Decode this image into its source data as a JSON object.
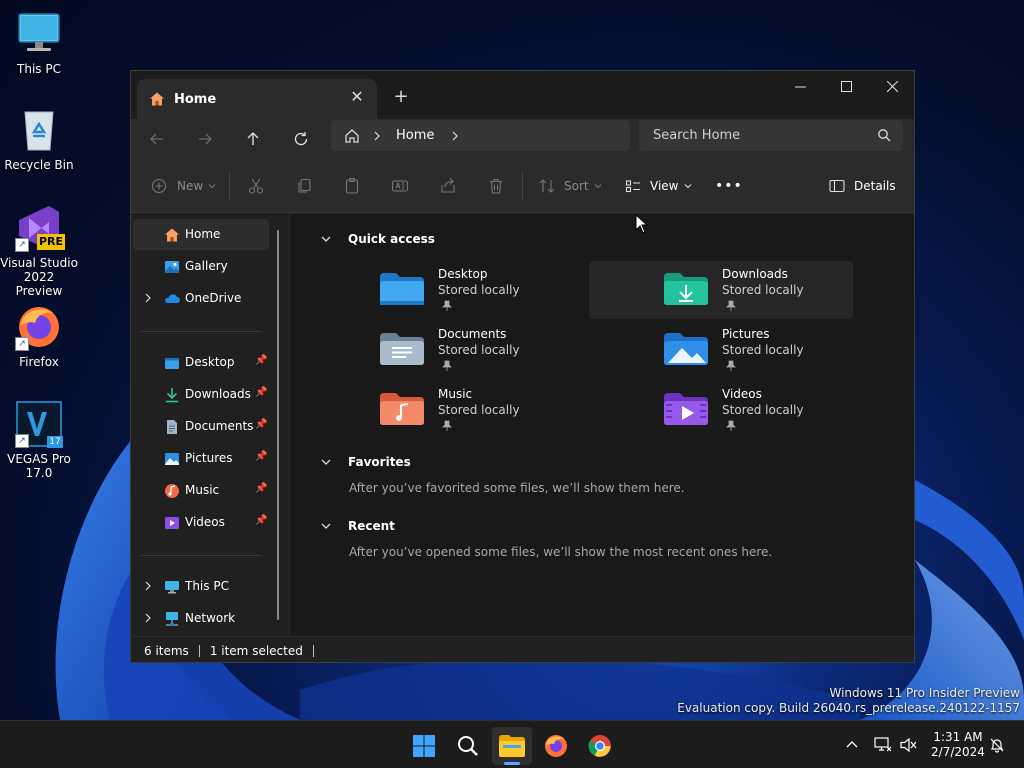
{
  "desktop": {
    "icons": [
      {
        "label": "This PC"
      },
      {
        "label": "Recycle Bin"
      },
      {
        "label": "Visual Studio 2022 Preview",
        "badge": "PRE"
      },
      {
        "label": "Firefox"
      },
      {
        "label": "VEGAS Pro 17.0",
        "badge": "17"
      }
    ],
    "watermark": {
      "line1": "Windows 11 Pro Insider Preview",
      "line2": "Evaluation copy. Build 26040.rs_prerelease.240122-1157"
    }
  },
  "window": {
    "tab_title": "Home",
    "new_tab_symbol": "+",
    "address": {
      "segments": [
        "Home"
      ]
    },
    "search_placeholder": "Search Home",
    "toolbar": {
      "new_label": "New",
      "sort_label": "Sort",
      "view_label": "View",
      "more_label": "•••",
      "details_label": "Details"
    },
    "sidebar": {
      "top": [
        {
          "label": "Home",
          "icon": "home-icon"
        },
        {
          "label": "Gallery",
          "icon": "gallery-icon"
        },
        {
          "label": "OneDrive",
          "icon": "onedrive-icon"
        }
      ],
      "pinned": [
        {
          "label": "Desktop",
          "icon": "desktop-folder-icon"
        },
        {
          "label": "Downloads",
          "icon": "downloads-icon"
        },
        {
          "label": "Documents",
          "icon": "documents-icon"
        },
        {
          "label": "Pictures",
          "icon": "pictures-icon"
        },
        {
          "label": "Music",
          "icon": "music-icon"
        },
        {
          "label": "Videos",
          "icon": "videos-icon"
        }
      ],
      "bottom": [
        {
          "label": "This PC",
          "icon": "this-pc-icon"
        },
        {
          "label": "Network",
          "icon": "network-icon"
        }
      ]
    },
    "main": {
      "quick_access_title": "Quick access",
      "quick_access": [
        {
          "name": "Desktop",
          "sub": "Stored locally"
        },
        {
          "name": "Downloads",
          "sub": "Stored locally"
        },
        {
          "name": "Documents",
          "sub": "Stored locally"
        },
        {
          "name": "Pictures",
          "sub": "Stored locally"
        },
        {
          "name": "Music",
          "sub": "Stored locally"
        },
        {
          "name": "Videos",
          "sub": "Stored locally"
        }
      ],
      "favorites_title": "Favorites",
      "favorites_empty": "After you’ve favorited some files, we’ll show them here.",
      "recent_title": "Recent",
      "recent_empty": "After you’ve opened some files, we’ll show the most recent ones here."
    },
    "status": {
      "items_count": "6 items",
      "selected": "1 item selected"
    }
  },
  "taskbar": {
    "clock_time": "1:31 AM",
    "clock_date": "2/7/2024"
  },
  "colors": {
    "accent": "#58a8ff",
    "window_bg": "#202020",
    "main_bg": "#191919"
  }
}
